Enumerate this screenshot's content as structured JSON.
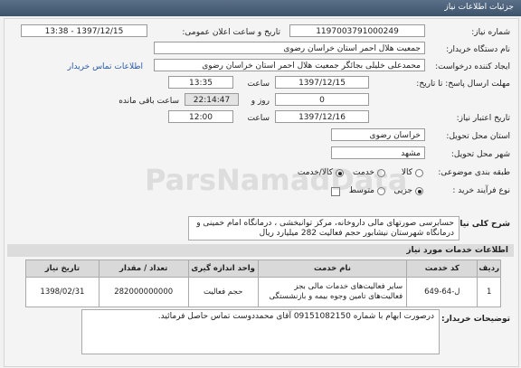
{
  "header": {
    "title": "جزئیات اطلاعات نیاز"
  },
  "labels": {
    "need_number": "شماره نیاز:",
    "announce_datetime": "تاریخ و ساعت اعلان عمومی:",
    "buyer_org": "نام دستگاه خریدار:",
    "requester": "ایجاد کننده درخواست:",
    "contact_link": "اطلاعات تماس خریدار",
    "send_deadline": "مهلت ارسال پاسخ: تا تاریخ:",
    "time": "ساعت",
    "days_and": "روز و",
    "remaining": "ساعت باقی مانده",
    "validity": "تاریخ اعتبار نیاز:",
    "province": "استان محل تحویل:",
    "city": "شهر محل تحویل:",
    "classification": "طبقه بندی موضوعی:",
    "process": "نوع فرآیند خرید :",
    "overall_desc": "شرح کلی نیاز:",
    "services_info": "اطلاعات خدمات مورد نیاز",
    "notes": "توضیحات خریدار:"
  },
  "values": {
    "need_number": "1197003791000249",
    "announce_datetime": "1397/12/15 - 13:38",
    "buyer_org": "جمعیت هلال احمر استان خراسان رضوی",
    "requester": "محمدعلی خلیلی بجائگر جمعیت هلال احمر استان خراسان رضوی",
    "send_date": "1397/12/15",
    "send_time": "13:35",
    "days": "0",
    "remaining_time": "22:14:47",
    "validity_date": "1397/12/16",
    "validity_time": "12:00",
    "province": "خراسان رضوی",
    "city": "مشهد"
  },
  "classification_options": [
    {
      "label": "کالا",
      "checked": false
    },
    {
      "label": "خدمت",
      "checked": false
    },
    {
      "label": "کالا/خدمت",
      "checked": true
    }
  ],
  "process_options": [
    {
      "label": "جزیی",
      "checked": true
    },
    {
      "label": "متوسط",
      "checked": false
    }
  ],
  "overall_description": "حسابرسی صورتهای مالی داروخانه، مرکز توانبخشی ، درمانگاه امام خمینی و درمانگاه شهرستان نیشابور حجم فعالیت 282 میلیارد ریال",
  "table": {
    "headers": [
      "ردیف",
      "کد خدمت",
      "نام خدمت",
      "واحد اندازه گیری",
      "تعداد / مقدار",
      "تاریخ نیاز"
    ],
    "rows": [
      [
        "1",
        "ل-64-649",
        "سایر فعالیت‌های خدمات مالی بجز فعالیت‌های تامین وجوه بیمه و بازنشستگی",
        "حجم فعالیت",
        "282000000000",
        "1398/02/31"
      ]
    ]
  },
  "buyer_notes": "درصورت ابهام با شماره 09151082150 آقای محمددوست تماس حاصل فرمائید.",
  "watermark": "ParsNamadData"
}
